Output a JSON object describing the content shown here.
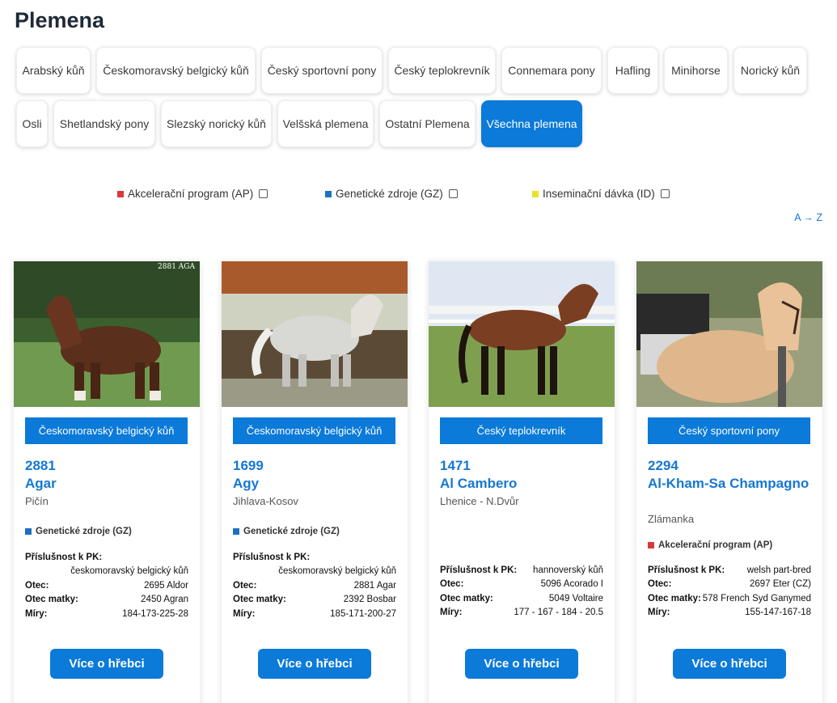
{
  "page": {
    "title": "Plemena"
  },
  "breeds_row1": [
    "Arabský kůň",
    "Českomoravský belgický kůň",
    "Český sportovní pony",
    "Český teplokrevník",
    "Connemara pony",
    "Hafling",
    "Minihorse",
    "Norický kůň"
  ],
  "breeds_row2": [
    "Osli",
    "Shetlandský pony",
    "Slezský norický kůň",
    "Velšská plemena",
    "Ostatní Plemena",
    "Všechna plemena"
  ],
  "filters": {
    "ap": {
      "label": "Akcelerační program (AP)",
      "color": "#d63a3a"
    },
    "gz": {
      "label": "Genetické zdroje (GZ)",
      "color": "#1f6fc0"
    },
    "id": {
      "label": "Inseminační dávka (ID)",
      "color": "#e8e424"
    }
  },
  "sort": {
    "label": "A → Z"
  },
  "labels": {
    "pk": "Příslušnost k PK:",
    "otec": "Otec:",
    "otec_matky": "Otec matky:",
    "miry": "Míry:",
    "more": "Více o hřebci"
  },
  "cards": [
    {
      "photo_label": "2881 AGA",
      "breed": "Českomoravský belgický kůň",
      "number": "2881",
      "name": "Agar",
      "place": "Pičín",
      "tag": "Genetické zdroje (GZ)",
      "tag_color": "#1f6fc0",
      "pk": "českomoravský belgický kůň",
      "otec": "2695 Aldor",
      "otec_matky": "2450 Agran",
      "miry": "184-173-225-28"
    },
    {
      "photo_label": "",
      "breed": "Českomoravský belgický kůň",
      "number": "1699",
      "name": "Agy",
      "place": "Jihlava-Kosov",
      "tag": "Genetické zdroje (GZ)",
      "tag_color": "#1f6fc0",
      "pk": "českomoravský belgický kůň",
      "otec": "2881 Agar",
      "otec_matky": "2392 Bosbar",
      "miry": "185-171-200-27"
    },
    {
      "photo_label": "",
      "breed": "Český teplokrevník",
      "number": "1471",
      "name": "Al Cambero",
      "place": "Lhenice - N.Dvůr",
      "tag": "",
      "tag_color": "",
      "pk": "hannoverský kůň",
      "otec": "5096 Acorado I",
      "otec_matky": "5049 Voltaire",
      "miry": "177 - 167 - 184 - 20.5"
    },
    {
      "photo_label": "",
      "breed": "Český sportovní pony",
      "number": "2294",
      "name": "Al-Kham-Sa Champagno",
      "place": "Zlámanka",
      "tag": "Akcelerační program (AP)",
      "tag_color": "#d63a3a",
      "pk": "welsh part-bred",
      "otec": "2697 Eter (CZ)",
      "otec_matky": "578 French Syd Ganymed",
      "miry": "155-147-167-18"
    }
  ]
}
